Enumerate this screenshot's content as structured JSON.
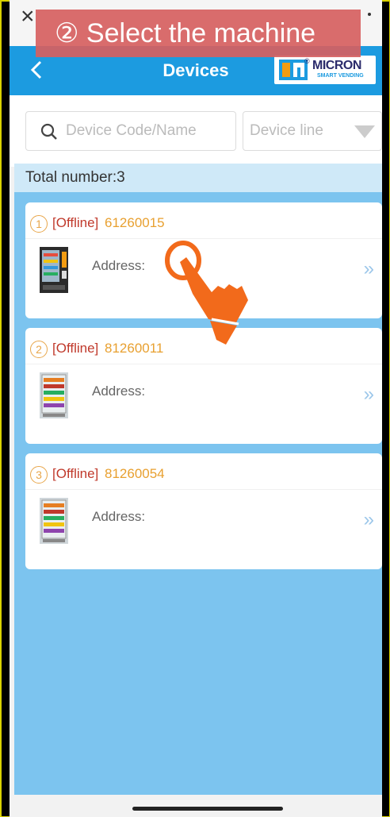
{
  "tutorial": {
    "step_text": "② Select the machine"
  },
  "system": {
    "close_glyph": "×"
  },
  "header": {
    "title": "Devices",
    "brand_name": "MICRON",
    "brand_reg": "®",
    "brand_sub": "SMART VENDING",
    "back_icon": "chevron-left-icon"
  },
  "search": {
    "placeholder": "Device Code/Name",
    "dropdown_label": "Device line"
  },
  "list": {
    "total_label": "Total number:3",
    "devices": [
      {
        "index": "1",
        "status": "[Offline]",
        "code": "61260015",
        "address_label": "Address:",
        "more": "»"
      },
      {
        "index": "2",
        "status": "[Offline]",
        "code": "81260011",
        "address_label": "Address:",
        "more": "»"
      },
      {
        "index": "3",
        "status": "[Offline]",
        "code": "81260054",
        "address_label": "Address:",
        "more": "»"
      }
    ]
  },
  "colors": {
    "header_blue": "#1c9be0",
    "list_blue": "#7cc4ef",
    "status_red": "#c0392b",
    "code_orange": "#e8a030",
    "hand_orange": "#f26a1b"
  }
}
